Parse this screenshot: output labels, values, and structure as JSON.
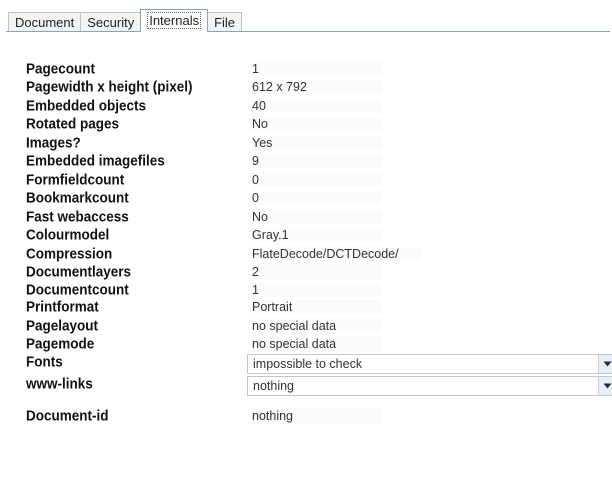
{
  "tabs": [
    {
      "label": "Document"
    },
    {
      "label": "Security"
    },
    {
      "label": "Internals"
    },
    {
      "label": "File"
    }
  ],
  "active_tab": "Internals",
  "fields": [
    {
      "label": "Pagecount",
      "value": "1"
    },
    {
      "label": "Pagewidth x height (pixel)",
      "value": "612 x 792"
    },
    {
      "label": "Embedded objects",
      "value": "40"
    },
    {
      "label": "Rotated pages",
      "value": "No"
    },
    {
      "label": "Images?",
      "value": "Yes"
    },
    {
      "label": "Embedded imagefiles",
      "value": "9"
    },
    {
      "label": "Formfieldcount",
      "value": "0"
    },
    {
      "label": "Bookmarkcount",
      "value": "0"
    },
    {
      "label": "Fast webaccess",
      "value": "No"
    },
    {
      "label": "Colourmodel",
      "value": "Gray.1"
    },
    {
      "label": "Compression",
      "value": "FlateDecode/DCTDecode/"
    },
    {
      "label": "Documentlayers",
      "value": "2"
    },
    {
      "label": "Documentcount",
      "value": "1"
    },
    {
      "label": "Printformat",
      "value": "Portrait"
    },
    {
      "label": "Pagelayout",
      "value": "no special data"
    },
    {
      "label": "Pagemode",
      "value": "no special data"
    }
  ],
  "fonts": {
    "label": "Fonts",
    "value": "impossible to check"
  },
  "links": {
    "label": "www-links",
    "value": "nothing"
  },
  "document_id": {
    "label": "Document-id",
    "value": "nothing"
  },
  "icons": {
    "dropdown": "chevron-down-icon"
  }
}
